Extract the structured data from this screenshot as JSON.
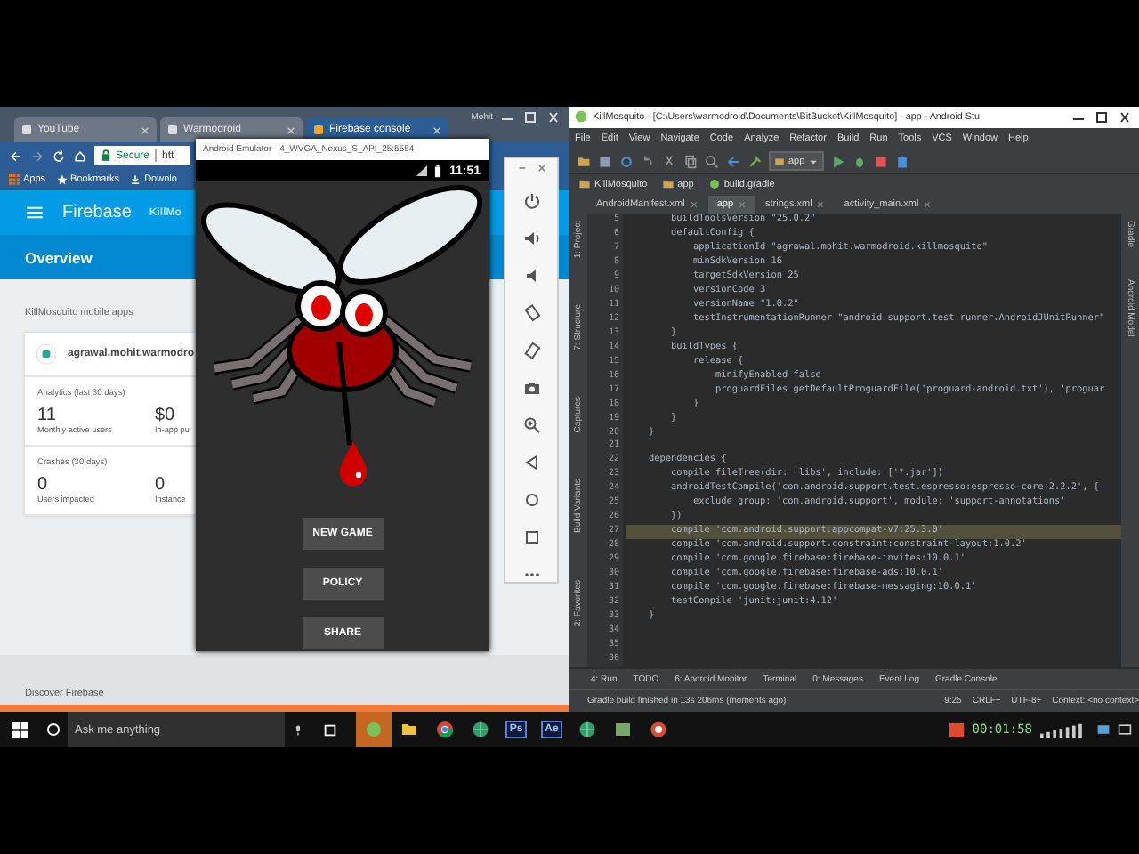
{
  "browser": {
    "window_title": "Mohit",
    "tabs": [
      {
        "label": "YouTube",
        "selected": false
      },
      {
        "label": "Warmodroid",
        "selected": false
      },
      {
        "label": "Firebase console",
        "selected": true
      }
    ],
    "secure_label": "Secure",
    "url": "htt",
    "bookmarks": [
      "Apps",
      "Bookmarks",
      "Downlo"
    ],
    "brand": "Firebase",
    "project": "KillMo",
    "nav_title": "Overview",
    "section_title": "KillMosquito mobile apps",
    "app_package": "agrawal.mohit.warmodro",
    "groups": [
      {
        "title": "Analytics (last 30 days)",
        "stats": [
          {
            "value": "11",
            "label": "Monthly active users"
          },
          {
            "value": "$0",
            "label": "In-app pu"
          }
        ]
      },
      {
        "title": "Crashes (30 days)",
        "stats": [
          {
            "value": "0",
            "label": "Users impacted"
          },
          {
            "value": "0",
            "label": "Instance"
          }
        ]
      }
    ],
    "footer": "Discover Firebase"
  },
  "emulator": {
    "title": "Android Emulator - 4_WVGA_Nexus_S_API_25:5554",
    "time": "11:51",
    "buttons": [
      "NEW GAME",
      "POLICY",
      "SHARE"
    ]
  },
  "emulator_toolbar": [
    {
      "kind": "power"
    },
    {
      "kind": "volume-up"
    },
    {
      "kind": "volume-down"
    },
    {
      "kind": "rotate-left"
    },
    {
      "kind": "rotate-right"
    },
    {
      "kind": "camera"
    },
    {
      "kind": "zoom"
    },
    {
      "kind": "back"
    },
    {
      "kind": "home"
    },
    {
      "kind": "overview"
    },
    {
      "kind": "more"
    }
  ],
  "ide": {
    "title": "KillMosquito - [C:\\Users\\warmodroid\\Documents\\BitBucket\\KillMosquito] - app - Android Stu",
    "menu": [
      "File",
      "Edit",
      "View",
      "Navigate",
      "Code",
      "Analyze",
      "Refactor",
      "Build",
      "Run",
      "Tools",
      "VCS",
      "Window",
      "Help"
    ],
    "run_config": "app",
    "breadcrumb": [
      "KillMosquito",
      "app",
      "build.gradle"
    ],
    "tabs": [
      {
        "label": "AndroidManifest.xml",
        "selected": false
      },
      {
        "label": "app",
        "selected": true
      },
      {
        "label": "strings.xml",
        "selected": false
      },
      {
        "label": "activity_main.xml",
        "selected": false
      }
    ],
    "left_tools": [
      "1: Project",
      "7: Structure",
      "Captures",
      "Build Variants",
      "2: Favorites"
    ],
    "right_tools": [
      "Gradle",
      "Android Model"
    ],
    "code": [
      {
        "number": "5",
        "text": "        buildToolsVersion \"25.0.2\"",
        "highlighted": false
      },
      {
        "number": "6",
        "text": "        defaultConfig {",
        "highlighted": false
      },
      {
        "number": "7",
        "text": "            applicationId \"agrawal.mohit.warmodroid.killmosquito\"",
        "highlighted": false
      },
      {
        "number": "8",
        "text": "            minSdkVersion 16",
        "highlighted": false
      },
      {
        "number": "9",
        "text": "            targetSdkVersion 25",
        "highlighted": false
      },
      {
        "number": "10",
        "text": "            versionCode 3",
        "highlighted": false
      },
      {
        "number": "11",
        "text": "            versionName \"1.0.2\"",
        "highlighted": false
      },
      {
        "number": "12",
        "text": "            testInstrumentationRunner \"android.support.test.runner.AndroidJUnitRunner\"",
        "highlighted": false
      },
      {
        "number": "13",
        "text": "        }",
        "highlighted": false
      },
      {
        "number": "14",
        "text": "        buildTypes {",
        "highlighted": false
      },
      {
        "number": "15",
        "text": "            release {",
        "highlighted": false
      },
      {
        "number": "16",
        "text": "                minifyEnabled false",
        "highlighted": false
      },
      {
        "number": "17",
        "text": "                proguardFiles getDefaultProguardFile('proguard-android.txt'), 'proguar",
        "highlighted": false
      },
      {
        "number": "18",
        "text": "            }",
        "highlighted": false
      },
      {
        "number": "19",
        "text": "        }",
        "highlighted": false
      },
      {
        "number": "20",
        "text": "    }",
        "highlighted": false
      },
      {
        "number": "21",
        "highlighted": false
      },
      {
        "number": "22",
        "text": "    dependencies {",
        "highlighted": false
      },
      {
        "number": "23",
        "text": "        compile fileTree(dir: 'libs', include: ['*.jar'])",
        "highlighted": false
      },
      {
        "number": "24",
        "text": "        androidTestCompile('com.android.support.test.espresso:espresso-core:2.2.2', {",
        "highlighted": false
      },
      {
        "number": "25",
        "text": "            exclude group: 'com.android.support', module: 'support-annotations'",
        "highlighted": false
      },
      {
        "number": "26",
        "text": "        })",
        "highlighted": false
      },
      {
        "number": "27",
        "text": "        compile 'com.android.support:appcompat-v7:25.3.0'",
        "highlighted": true
      },
      {
        "number": "28",
        "text": "        compile 'com.android.support.constraint:constraint-layout:1.0.2'",
        "highlighted": false
      },
      {
        "number": "29",
        "text": "        compile 'com.google.firebase:firebase-invites:10.0.1'",
        "highlighted": false
      },
      {
        "number": "30",
        "text": "        compile 'com.google.firebase:firebase-ads:10.0.1'",
        "highlighted": false
      },
      {
        "number": "31",
        "text": "        compile 'com.google.firebase:firebase-messaging:10.0.1'",
        "highlighted": false
      },
      {
        "number": "32",
        "text": "        testCompile 'junit:junit:4.12'",
        "highlighted": false
      },
      {
        "number": "33",
        "text": "    }",
        "highlighted": false
      },
      {
        "number": "34",
        "highlighted": false
      },
      {
        "number": "35",
        "highlighted": false
      },
      {
        "number": "36",
        "highlighted": false
      }
    ],
    "tool_windows": [
      "4: Run",
      "TODO",
      "6: Android Monitor",
      "Terminal",
      "0: Messages",
      "Event Log",
      "Gradle Console"
    ],
    "status_message": "Gradle build finished in 13s 206ms (moments ago)",
    "status_items": [
      "9:25",
      "CRLF÷",
      "UTF-8÷",
      "Context: <no context>"
    ]
  },
  "taskbar": {
    "search_placeholder": "Ask me anything",
    "apps": [
      {
        "kind": "studio",
        "active": true
      },
      {
        "kind": "folder",
        "active": false
      },
      {
        "kind": "chrome",
        "active": false
      },
      {
        "kind": "globe",
        "active": false
      },
      {
        "kind": "badge",
        "label": "Ps",
        "active": false
      },
      {
        "kind": "badge",
        "label": "Ae",
        "active": false
      },
      {
        "kind": "globe",
        "active": false
      },
      {
        "kind": "map",
        "active": false
      },
      {
        "kind": "record",
        "active": false
      }
    ],
    "timer": "00:01:58"
  }
}
